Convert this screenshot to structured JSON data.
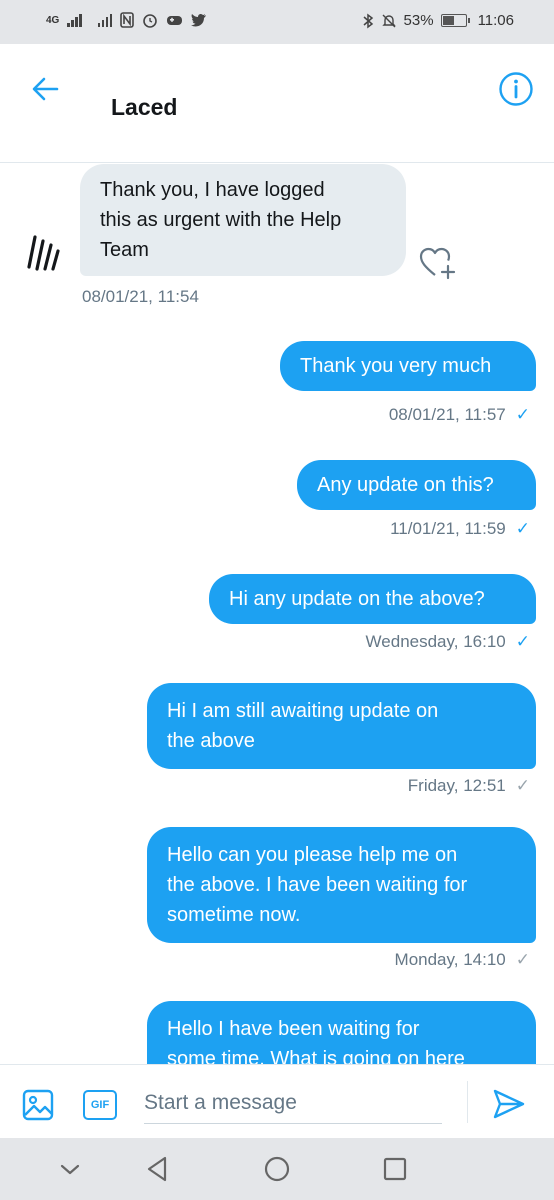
{
  "status_bar": {
    "network": "4G",
    "battery_percent": "53%",
    "time": "11:06"
  },
  "header": {
    "title": "Laced",
    "back_icon": "arrow-left-icon",
    "info_icon": "info-circle-icon"
  },
  "messages": [
    {
      "direction": "in",
      "lines": [
        "Thank you, I have logged",
        "this as urgent with the Help",
        "Team"
      ],
      "time": "08/01/21, 11:54",
      "has_avatar": true
    },
    {
      "direction": "out",
      "lines": [
        "Thank you very much"
      ],
      "time": "08/01/21, 11:57",
      "read": true
    },
    {
      "direction": "out",
      "lines": [
        "Any update on this?"
      ],
      "time": "11/01/21, 11:59",
      "read": true
    },
    {
      "direction": "out",
      "lines": [
        "Hi any update on the above?"
      ],
      "time": "Wednesday, 16:10",
      "read": true
    },
    {
      "direction": "out",
      "lines": [
        "Hi I am still awaiting update on",
        "the above"
      ],
      "time": "Friday, 12:51",
      "read": false
    },
    {
      "direction": "out",
      "lines": [
        "Hello can you please help me on",
        "the above. I have been waiting for",
        "sometime now."
      ],
      "time": "Monday, 14:10",
      "read": false
    },
    {
      "direction": "out",
      "lines": [
        "Hello I have been waiting for",
        "some time. What is going on here"
      ],
      "time": "",
      "read": false
    }
  ],
  "composer": {
    "placeholder": "Start a message",
    "gif_label": "GIF"
  },
  "check_mark": "✓",
  "colors": {
    "accent": "#1da1f2",
    "incoming_bubble": "#e6ecf0",
    "timestamp": "#657786"
  }
}
